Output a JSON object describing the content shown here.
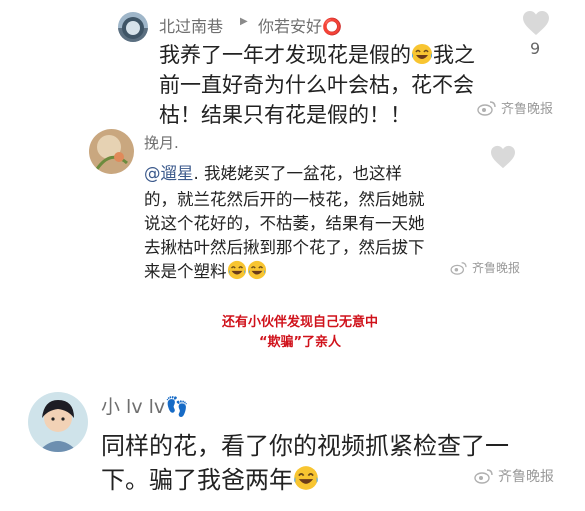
{
  "comment1": {
    "username": "北过南巷",
    "reply_arrow": "▶",
    "reply_to": "你若安好⭕",
    "text_line1": "我养了一年才发现花是假的",
    "text_line1_tail": "我之",
    "text_line2": "前一直好奇为什么叶会枯，花不会",
    "text_line3": "枯！结果只有花是假的！！",
    "like_count": "9",
    "watermark": "齐鲁晚报"
  },
  "comment2": {
    "username": "挽月.",
    "mention": "@遛星",
    "text_line1_rest": ". 我姥姥买了一盆花，也这样",
    "text_line2": "的，就兰花然后开的一枝花，然后她就",
    "text_line3": "说这个花好的，不枯萎，结果有一天她",
    "text_line4": "去揪枯叶然后揪到那个花了，然后拔下",
    "text_line5": "来是个塑料",
    "watermark": "齐鲁晚报"
  },
  "caption": {
    "line1": "还有小伙伴发现自己无意中",
    "line2": "“欺骗”了亲人"
  },
  "comment3": {
    "username": "小 lv lv👣",
    "text_line1": "同样的花，看了你的视频抓紧检查了一",
    "text_line2": "下。骗了我爸两年",
    "watermark": "齐鲁晚报"
  },
  "icons": {
    "heart": "heart-icon",
    "emoji_laugh_cry": "laughing-crying-emoji-icon",
    "emoji_laugh": "laughing-emoji-icon",
    "weibo": "weibo-logo-icon"
  },
  "colors": {
    "username": "#6f6f6f",
    "mention": "#3c5a8c",
    "caption": "#d0121b",
    "heart": "#d9d9d9"
  }
}
